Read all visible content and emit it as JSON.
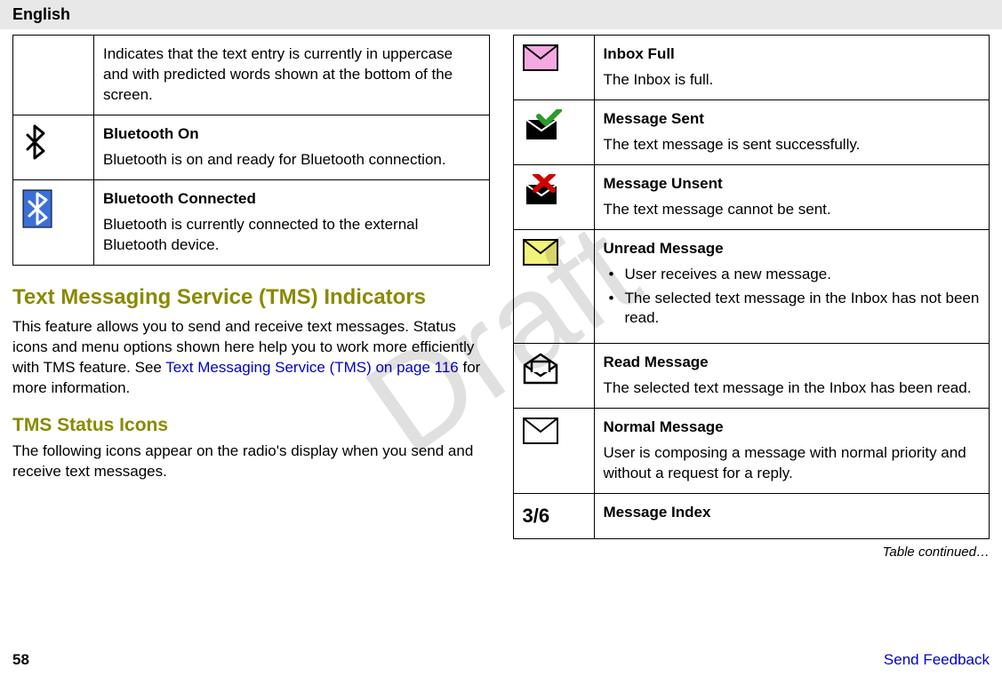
{
  "header": {
    "language": "English"
  },
  "watermark": "Draft",
  "left": {
    "upper_desc": "Indicates that the text entry is currently in uppercase and with predicted words shown at the bottom of the screen.",
    "bt_on": {
      "title": "Bluetooth On",
      "desc": "Bluetooth is on and ready for Bluetooth connection."
    },
    "bt_conn": {
      "title": "Bluetooth Connected",
      "desc": "Bluetooth is currently connected to the external Bluetooth device."
    },
    "sec_title": "Text Messaging Service (TMS) Indicators",
    "sec_body_pre": "This feature allows you to send and receive text messages. Status icons and menu options shown here help you to work more efficiently with TMS feature. See ",
    "sec_link": "Text Messaging Service (TMS) on page 116",
    "sec_body_post": " for more information.",
    "sub_title": "TMS Status Icons",
    "sub_body": "The following icons appear on the radio's display when you send and receive text messages."
  },
  "right": {
    "inbox_full": {
      "title": "Inbox Full",
      "desc": "The Inbox is full."
    },
    "sent": {
      "title": "Message Sent",
      "desc": "The text message is sent successfully."
    },
    "unsent": {
      "title": "Message Unsent",
      "desc": "The text message cannot be sent."
    },
    "unread": {
      "title": "Unread Message",
      "b1": "User receives a new message.",
      "b2": "The selected text message in the Inbox has not been read."
    },
    "read": {
      "title": "Read Message",
      "desc": "The selected text message in the Inbox has been read."
    },
    "normal": {
      "title": "Normal Message",
      "desc": "User is composing a message with normal priority and without a request for a reply."
    },
    "index": {
      "title": "Message Index",
      "icon_text": "3/6"
    },
    "table_continued": "Table continued…"
  },
  "footer": {
    "page": "58",
    "feedback": "Send Feedback"
  }
}
